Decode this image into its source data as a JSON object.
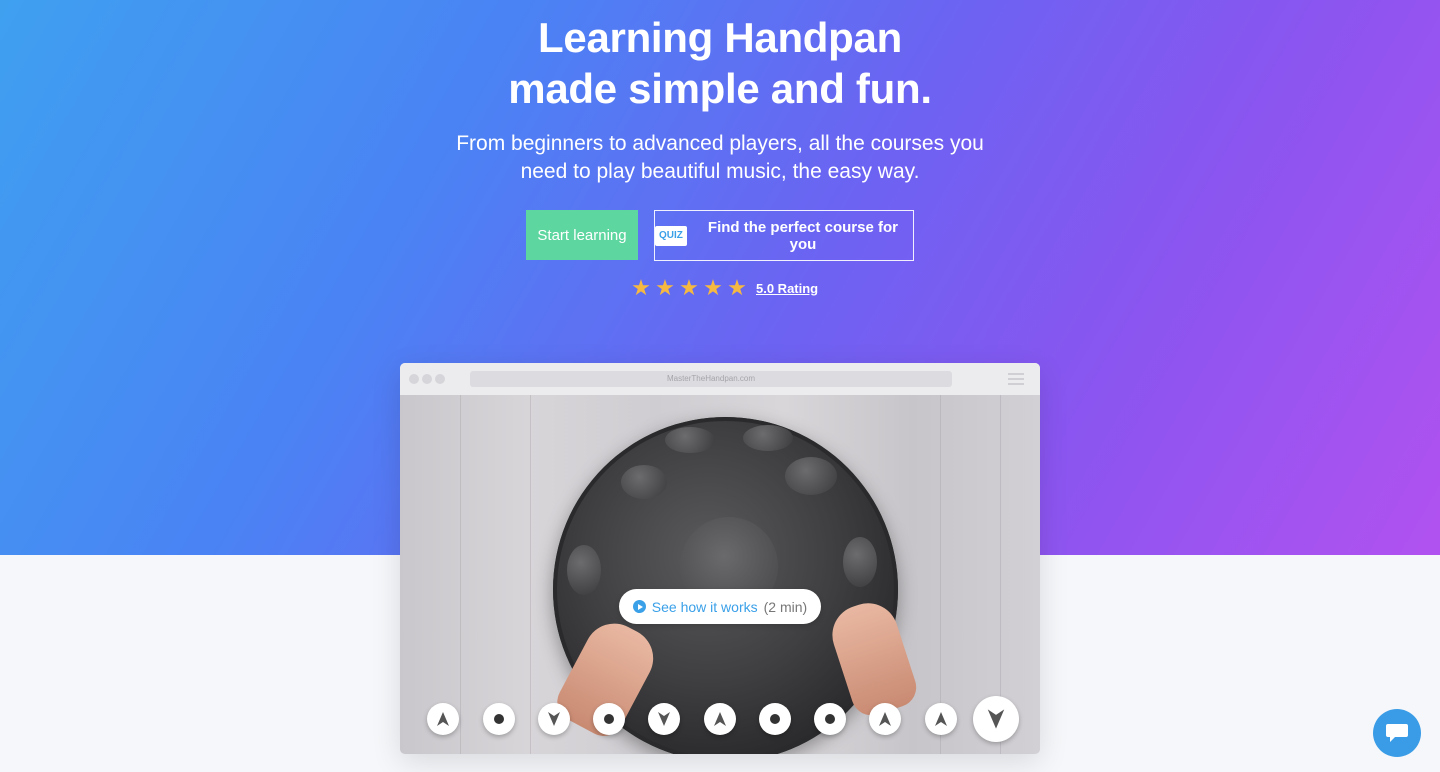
{
  "hero": {
    "title_line1": "Learning Handpan",
    "title_line2": "made simple and fun.",
    "subtitle_line1": "From beginners to advanced players, all the courses you",
    "subtitle_line2": "need to play beautiful music, the easy way.",
    "start_button": "Start learning",
    "quiz_badge": "QUIZ",
    "quiz_button": "Find the perfect course for you",
    "rating_stars": 5,
    "rating_link": "5.0 Rating",
    "colors": {
      "start": "#5ed6a0",
      "star": "#f5b942",
      "accent": "#3aa0e8"
    }
  },
  "browser": {
    "url": "MasterTheHandpan.com",
    "video_cta_label": "See how it works",
    "video_cta_duration": "(2 min)",
    "note_markers": [
      "up-arrow",
      "dot",
      "down-arrow",
      "dot",
      "down-arrow",
      "up-arrow",
      "dot",
      "dot",
      "up-arrow",
      "up-arrow",
      "down-arrow"
    ]
  },
  "chat": {
    "icon": "chat-bubble-icon"
  }
}
